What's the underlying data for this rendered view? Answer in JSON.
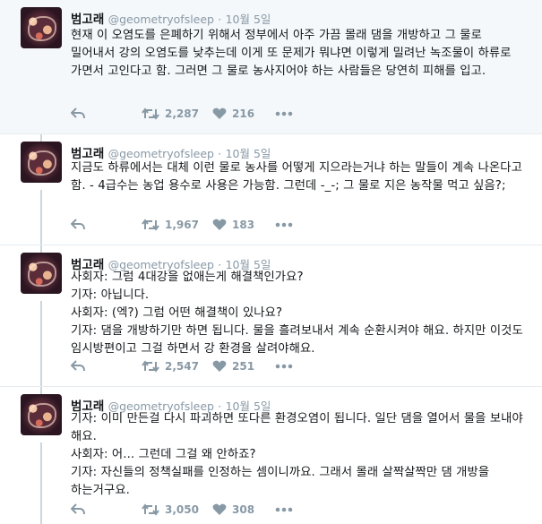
{
  "tweets": [
    {
      "name": "범고래",
      "handle": "@geometryofsleep",
      "dot": "·",
      "time": "10월 5일",
      "text": "현재 이 오염도를 은폐하기 위해서 정부에서 아주 가끔 몰래 댐을 개방하고 그 물로 밀어내서 강의 오염도를 낮추는데 이게 또 문제가 뭐냐면 이렇게 밀려난 녹조물이 하류로 가면서 고인다고 함. 그러면 그 물로 농사지어야 하는 사람들은 당연히 피해를 입고.",
      "retweets": "2,287",
      "likes": "216"
    },
    {
      "name": "범고래",
      "handle": "@geometryofsleep",
      "dot": "·",
      "time": "10월 5일",
      "text": "지금도 하류에서는 대체 이런 물로 농사를 어떻게 지으라는거냐 하는 말들이 계속 나온다고 함. - 4급수는 농업 용수로 사용은 가능함. 그런데 -_-; 그 물로 지은 농작물 먹고 싶음?;",
      "retweets": "1,967",
      "likes": "183"
    },
    {
      "name": "범고래",
      "handle": "@geometryofsleep",
      "dot": "·",
      "time": "10월 5일",
      "text": "사회자: 그럼 4대강을 없애는게 해결책인가요?\n기자: 아닙니다.\n사회자: (엑?) 그럼 어떤 해결책이 있나요?\n기자: 댐을 개방하기만 하면 됩니다. 물을 흘려보내서 계속 순환시켜야 해요. 하지만 이것도 임시방편이고 그걸 하면서 강 환경을 살려야해요.",
      "retweets": "2,547",
      "likes": "251"
    },
    {
      "name": "범고래",
      "handle": "@geometryofsleep",
      "dot": "·",
      "time": "10월 5일",
      "text": "기자: 이미 만든걸 다시 파괴하면 또다른 환경오염이 됩니다. 일단 댐을 열어서 물을 보내야 해요.\n사회자: 어... 그런데 그걸 왜 안하죠?\n기자: 자신들의 정책실패를 인정하는 셈이니까요. 그래서 몰래 살짝살짝만 댐 개방을 하는거구요.",
      "retweets": "3,050",
      "likes": "308"
    }
  ],
  "icons": {
    "reply": "reply-icon",
    "retweet": "retweet-icon",
    "like": "heart-icon",
    "more": "more-icon"
  },
  "colors": {
    "icon": "#8899a6",
    "thread_line": "#ccd6dd",
    "highlight_bg": "#f5f8fa"
  }
}
